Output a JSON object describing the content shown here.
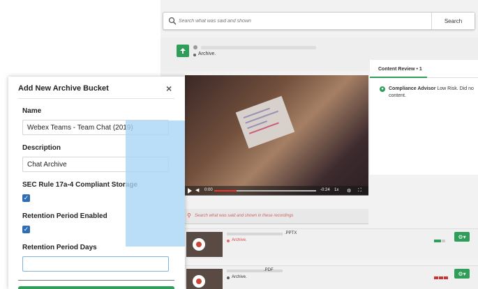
{
  "search": {
    "placeholder": "Search what was said and shown",
    "button_label": "Search"
  },
  "recording": {
    "status_label": "Archive."
  },
  "video": {
    "time_start": "0:00",
    "time_end": "-0:24",
    "speed": "1x",
    "progress": 0.22
  },
  "recording_search": {
    "placeholder": "Search what was said and shown in these recordings"
  },
  "content_review": {
    "tab_label": "Content Review • 1",
    "advisor_name": "Compliance Advisor",
    "advisor_text": "Low Risk. Did no",
    "advisor_text_2": "content."
  },
  "recordings": [
    {
      "ext": ".PPTX",
      "type": "Archive."
    },
    {
      "ext": ".PDF",
      "type": "Archive."
    }
  ],
  "modal": {
    "title": "Add New Archive Bucket",
    "close": "×",
    "name_label": "Name",
    "name_value": "Webex Teams - Team Chat (2019)",
    "description_label": "Description",
    "description_value": "Chat Archive",
    "sec_label": "SEC Rule 17a-4 Compliant Storage",
    "sec_checked": true,
    "retention_enabled_label": "Retention Period Enabled",
    "retention_enabled_checked": true,
    "retention_days_label": "Retention Period Days",
    "retention_days_value": ""
  },
  "colors": {
    "accent_green": "#2e9e5a",
    "checkbox_blue": "#2f6db5",
    "overlay_blue": "#a9d6f5"
  },
  "icons": {
    "search": "search-icon",
    "up": "arrow-up-icon",
    "gear": "gear-icon",
    "close": "close-icon",
    "check": "check-icon"
  }
}
